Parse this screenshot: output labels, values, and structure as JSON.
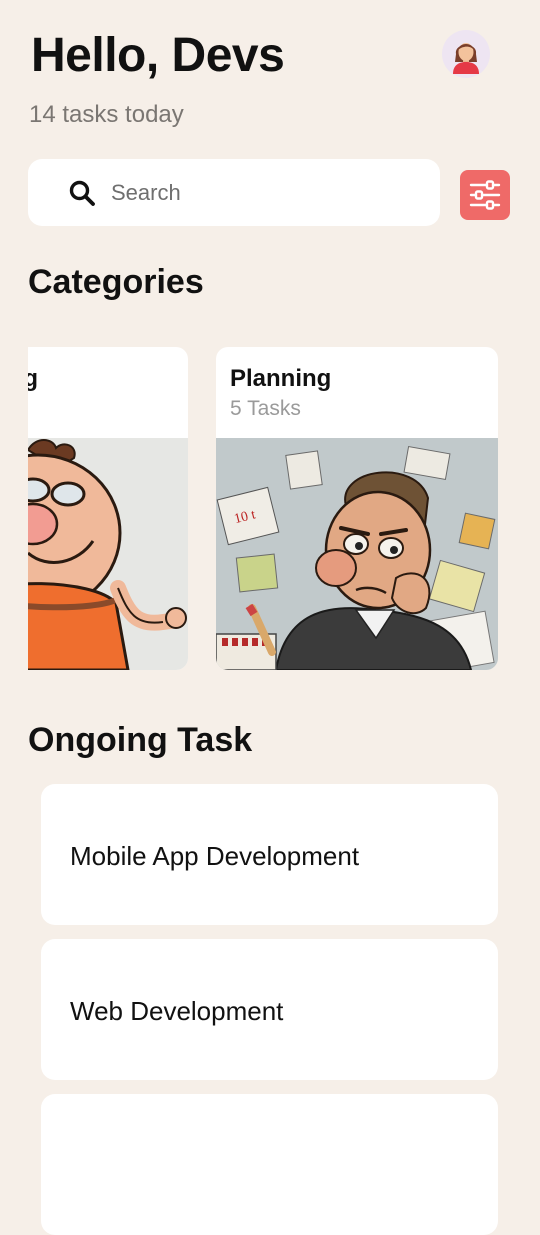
{
  "header": {
    "greeting": "Hello, Devs",
    "subtitle": "14 tasks today",
    "avatar_icon": "woman-avatar-icon"
  },
  "search": {
    "placeholder": "Search",
    "value": "",
    "icon": "search-icon"
  },
  "filter": {
    "icon": "sliders-icon",
    "color": "#EF6A68"
  },
  "categories": {
    "title": "Categories",
    "items": [
      {
        "title": "g",
        "count": "",
        "image": "cartoon-bald-man-illustration"
      },
      {
        "title": "Planning",
        "count": "5 Tasks",
        "image": "cartoon-thinking-man-with-notes-illustration"
      }
    ]
  },
  "ongoing": {
    "title": "Ongoing Task",
    "items": [
      {
        "title": "Mobile App Development"
      },
      {
        "title": "Web Development"
      },
      {
        "title": ""
      }
    ]
  },
  "colors": {
    "background": "#F6EFE8",
    "card": "#FFFFFF",
    "accent": "#EF6A68",
    "muted_text": "#7A7672"
  }
}
